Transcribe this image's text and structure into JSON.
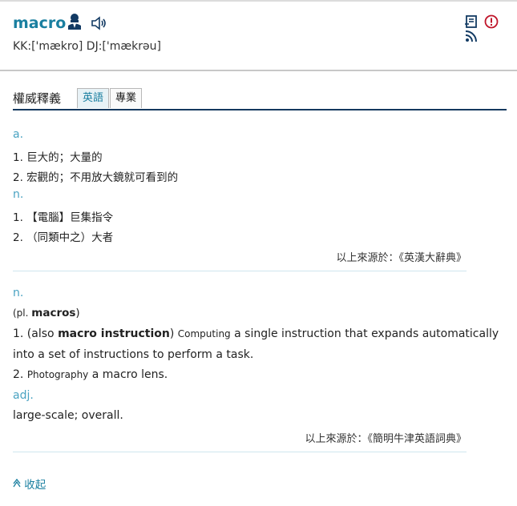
{
  "header": {
    "word": "macro",
    "pronunciation": "KK:['mækro] DJ:['mækrəu]"
  },
  "tabs": {
    "title": "權威釋義",
    "items": [
      {
        "label": "英語",
        "active": true
      },
      {
        "label": "專業",
        "active": false
      }
    ]
  },
  "block1": {
    "pos1": "a.",
    "def1": "1. 巨大的；大量的",
    "def2": "2. 宏觀的；不用放大鏡就可看到的",
    "pos2": "n.",
    "def3": "1. 【電腦】巨集指令",
    "def4": "2. （同類中之）大者",
    "source": "以上來源於：《英漢大辭典》"
  },
  "block2": {
    "pos1": "n.",
    "plural_prefix": "(pl. ",
    "plural_word": "macros",
    "plural_suffix": ")",
    "def1_prefix": "1. (also ",
    "def1_bold": "macro instruction",
    "def1_mid": ") ",
    "def1_label": "Computing",
    "def1_text": "  a single instruction that expands automatically",
    "def1_cont": "into a set of instructions to perform a task.",
    "def2_prefix": "2. ",
    "def2_label": "Photography",
    "def2_text": "  a macro lens.",
    "pos2": "adj.",
    "def3": "large-scale; overall.",
    "source": "以上來源於：《簡明牛津英語詞典》"
  },
  "footer": {
    "collapse": "收起"
  }
}
